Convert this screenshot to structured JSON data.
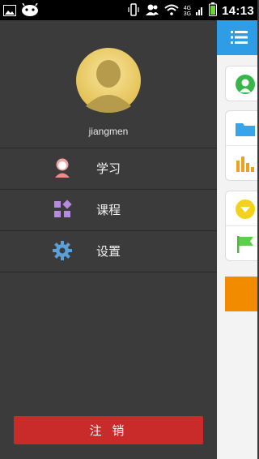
{
  "status_bar": {
    "time": "14:13",
    "network_top": "4G",
    "network_bottom": "3G",
    "icons": [
      "gallery-icon",
      "android-icon",
      "vibrate-icon",
      "contacts-icon",
      "wifi-icon",
      "signal-icon",
      "battery-icon"
    ]
  },
  "drawer": {
    "username": "jiangmen",
    "menu": [
      {
        "label": "学习",
        "icon": "study-icon",
        "color": "#f08a8a"
      },
      {
        "label": "课程",
        "icon": "courses-icon",
        "color": "#b48be0"
      },
      {
        "label": "设置",
        "icon": "settings-icon",
        "color": "#5b9fd8"
      }
    ],
    "logout_label": "注 销"
  },
  "main": {
    "header_icon": "menu-list-icon",
    "cards": [
      {
        "icons": [
          "person-icon"
        ]
      },
      {
        "icons": [
          "folder-icon",
          "bar-chart-icon"
        ]
      },
      {
        "icons": [
          "download-icon",
          "flag-icon"
        ]
      }
    ]
  },
  "colors": {
    "drawer_bg": "#3b3b3b",
    "header_blue": "#2f9ce6",
    "logout_red": "#c92a2a",
    "accent_orange": "#f28b00"
  }
}
